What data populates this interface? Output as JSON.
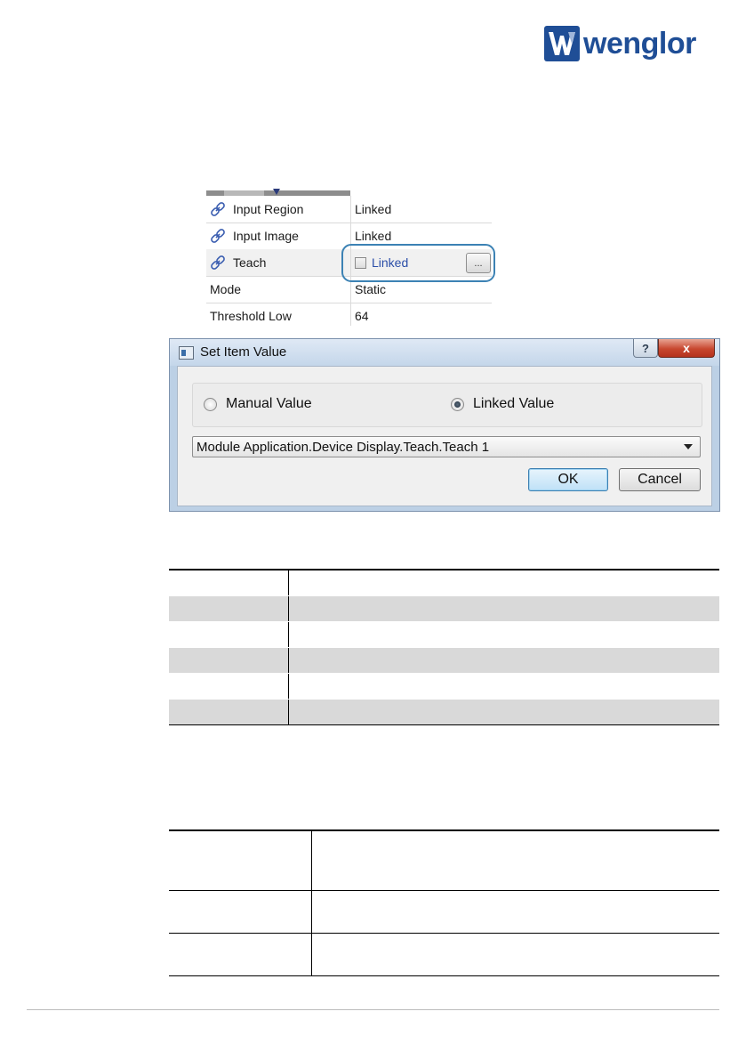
{
  "brand": {
    "name": "wenglor",
    "color": "#1f4e96"
  },
  "property_grid": {
    "rows": [
      {
        "name": "Input Region",
        "value": "Linked",
        "linked": true
      },
      {
        "name": "Input Image",
        "value": "Linked",
        "linked": true
      },
      {
        "name": "Teach",
        "value": "Linked",
        "linked": true,
        "has_checkbox": true,
        "checked": false,
        "button_label": "..."
      },
      {
        "name": "Mode",
        "value": "Static",
        "linked": false
      },
      {
        "name": "Threshold Low",
        "value": "64",
        "linked": false
      }
    ],
    "highlight_color": "#3c82b4"
  },
  "dialog": {
    "title": "Set Item Value",
    "help_label": "?",
    "close_label": "x",
    "options": [
      {
        "label": "Manual Value",
        "selected": false
      },
      {
        "label": "Linked Value",
        "selected": true
      }
    ],
    "selected_link": "Module Application.Device Display.Teach.Teach 1",
    "ok_label": "OK",
    "cancel_label": "Cancel"
  },
  "icons": {
    "link": "link-chain-icon",
    "dropdown": "chevron-down-icon"
  }
}
